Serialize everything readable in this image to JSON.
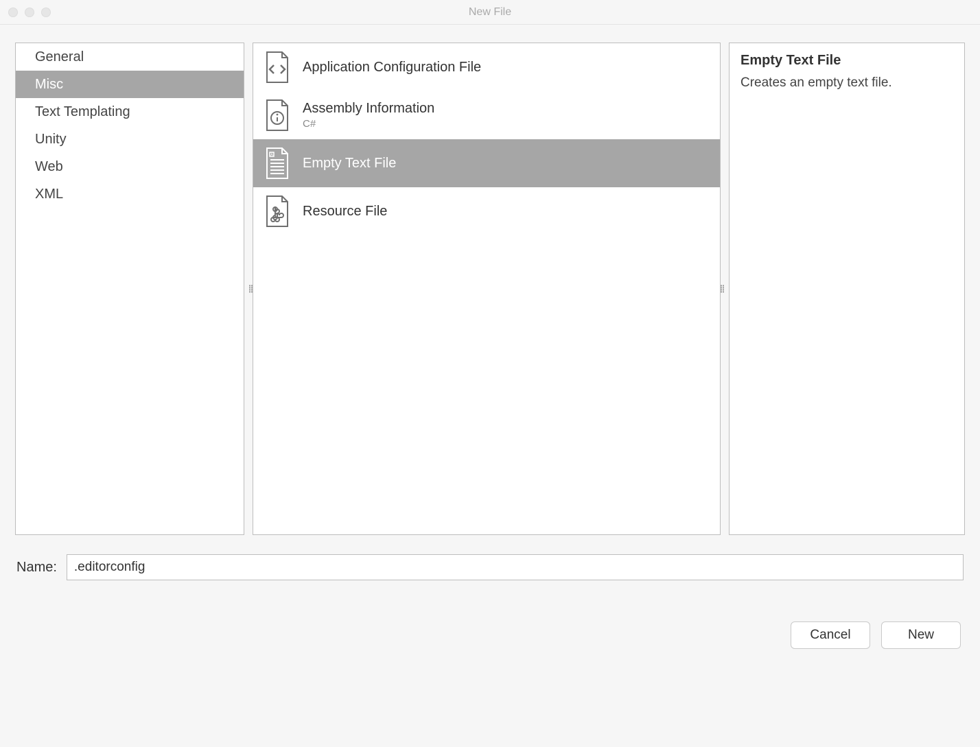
{
  "window": {
    "title": "New File"
  },
  "categories": {
    "items": [
      {
        "label": "General",
        "selected": false
      },
      {
        "label": "Misc",
        "selected": true
      },
      {
        "label": "Text Templating",
        "selected": false
      },
      {
        "label": "Unity",
        "selected": false
      },
      {
        "label": "Web",
        "selected": false
      },
      {
        "label": "XML",
        "selected": false
      }
    ]
  },
  "templates": {
    "items": [
      {
        "label": "Application Configuration File",
        "sub": "",
        "icon": "code-file-icon",
        "selected": false
      },
      {
        "label": "Assembly Information",
        "sub": "C#",
        "icon": "info-file-icon",
        "selected": false
      },
      {
        "label": "Empty Text File",
        "sub": "",
        "icon": "text-file-icon",
        "selected": true
      },
      {
        "label": "Resource File",
        "sub": "",
        "icon": "command-file-icon",
        "selected": false
      }
    ]
  },
  "description": {
    "title": "Empty Text File",
    "body": "Creates an empty text file."
  },
  "name_field": {
    "label": "Name:",
    "value": ".editorconfig"
  },
  "buttons": {
    "cancel": "Cancel",
    "new": "New"
  }
}
